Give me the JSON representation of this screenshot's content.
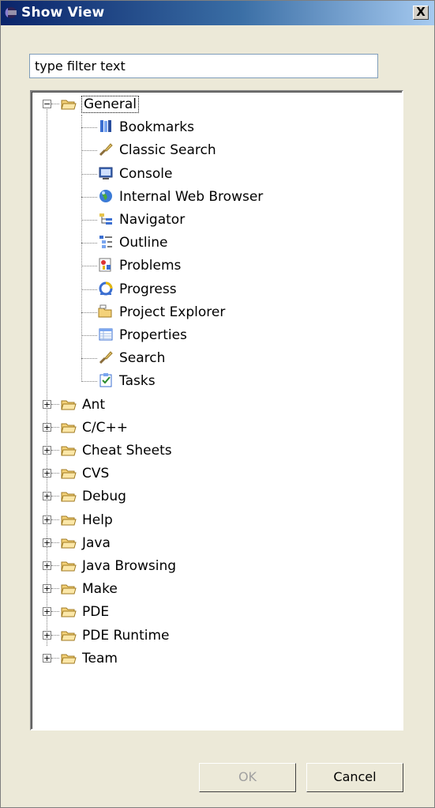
{
  "window": {
    "title": "Show View",
    "close_label": "X"
  },
  "filter": {
    "value": "type filter text"
  },
  "tree": {
    "general": {
      "label": "General",
      "children": [
        {
          "label": "Bookmarks",
          "icon": "bookmarks-icon"
        },
        {
          "label": "Classic Search",
          "icon": "classic-search-icon"
        },
        {
          "label": "Console",
          "icon": "console-icon"
        },
        {
          "label": "Internal Web Browser",
          "icon": "web-browser-icon"
        },
        {
          "label": "Navigator",
          "icon": "navigator-icon"
        },
        {
          "label": "Outline",
          "icon": "outline-icon"
        },
        {
          "label": "Problems",
          "icon": "problems-icon"
        },
        {
          "label": "Progress",
          "icon": "progress-icon"
        },
        {
          "label": "Project Explorer",
          "icon": "project-explorer-icon"
        },
        {
          "label": "Properties",
          "icon": "properties-icon"
        },
        {
          "label": "Search",
          "icon": "search-icon"
        },
        {
          "label": "Tasks",
          "icon": "tasks-icon"
        }
      ]
    },
    "categories": [
      "Ant",
      "C/C++",
      "Cheat Sheets",
      "CVS",
      "Debug",
      "Help",
      "Java",
      "Java Browsing",
      "Make",
      "PDE",
      "PDE Runtime",
      "Team"
    ]
  },
  "buttons": {
    "ok_label": "OK",
    "cancel_label": "Cancel"
  },
  "colors": {
    "folder": "#f4d27a",
    "title_start": "#0a246a",
    "title_end": "#a6caf0"
  }
}
